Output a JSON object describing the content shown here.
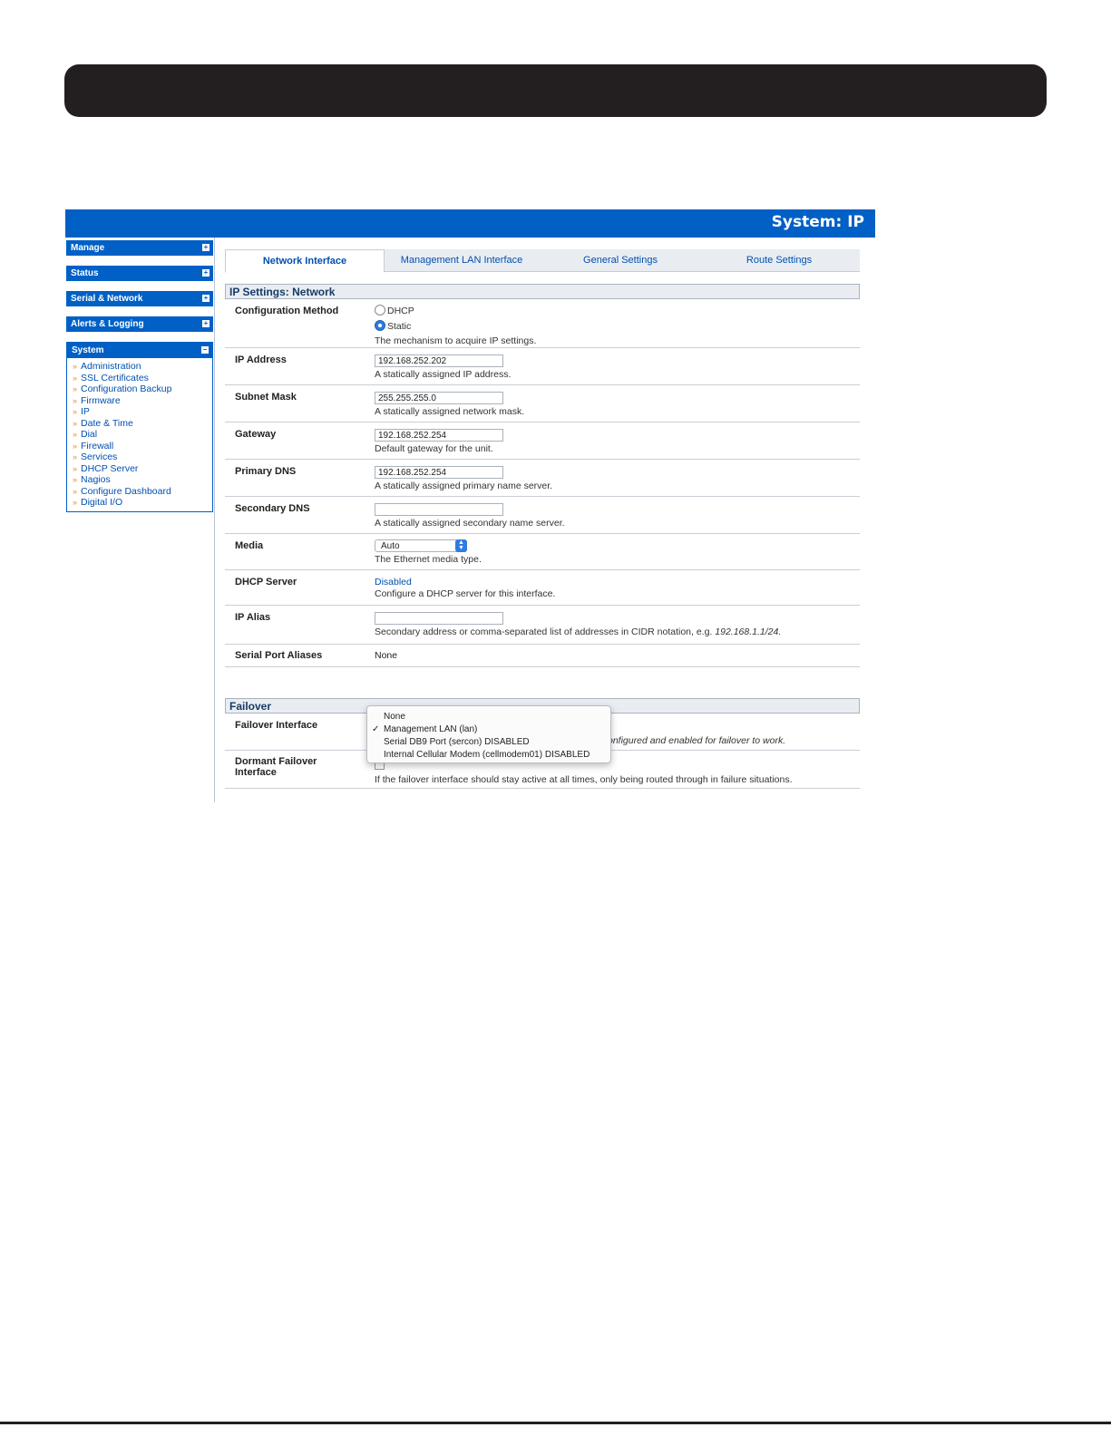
{
  "app": {
    "title": "System: IP"
  },
  "sidebar": {
    "sections": [
      {
        "label": "Manage",
        "toggle": "+"
      },
      {
        "label": "Status",
        "toggle": "+"
      },
      {
        "label": "Serial & Network",
        "toggle": "+"
      },
      {
        "label": "Alerts & Logging",
        "toggle": "+"
      }
    ],
    "system": {
      "label": "System",
      "toggle": "−",
      "items": [
        "Administration",
        "SSL Certificates",
        "Configuration Backup",
        "Firmware",
        "IP",
        "Date & Time",
        "Dial",
        "Firewall",
        "Services",
        "DHCP Server",
        "Nagios",
        "Configure Dashboard",
        "Digital I/O"
      ]
    }
  },
  "tabs": [
    {
      "label": "Network Interface",
      "active": true
    },
    {
      "label": "Management LAN Interface",
      "active": false
    },
    {
      "label": "General Settings",
      "active": false
    },
    {
      "label": "Route Settings",
      "active": false
    }
  ],
  "ip_settings": {
    "heading": "IP Settings: Network",
    "config_method": {
      "label": "Configuration Method",
      "options": [
        "DHCP",
        "Static"
      ],
      "selected": "Static",
      "hint": "The mechanism to acquire IP settings."
    },
    "ip_address": {
      "label": "IP Address",
      "value": "192.168.252.202",
      "hint": "A statically assigned IP address."
    },
    "subnet_mask": {
      "label": "Subnet Mask",
      "value": "255.255.255.0",
      "hint": "A statically assigned network mask."
    },
    "gateway": {
      "label": "Gateway",
      "value": "192.168.252.254",
      "hint": "Default gateway for the unit."
    },
    "primary_dns": {
      "label": "Primary DNS",
      "value": "192.168.252.254",
      "hint": "A statically assigned primary name server."
    },
    "secondary_dns": {
      "label": "Secondary DNS",
      "value": "",
      "hint": "A statically assigned secondary name server."
    },
    "media": {
      "label": "Media",
      "value": "Auto",
      "hint": "The Ethernet media type."
    },
    "dhcp_server": {
      "label": "DHCP Server",
      "value": "Disabled",
      "hint": "Configure a DHCP server for this interface."
    },
    "ip_alias": {
      "label": "IP Alias",
      "value": "",
      "hint": "Secondary address or comma-separated list of addresses in CIDR notation, e.g.",
      "hint_example": "192.168.1.1/24."
    },
    "serial_port_aliases": {
      "label": "Serial Port Aliases",
      "value": "None"
    }
  },
  "failover": {
    "heading": "Failover",
    "interface": {
      "label": "Failover Interface",
      "hint_partial": "onfigured and enabled for failover to work."
    },
    "dormant": {
      "label": "Dormant Failover Interface",
      "hint": "If the failover interface should stay active at all times, only being routed through in failure situations."
    },
    "dropdown_options": [
      {
        "label": "None",
        "checked": false
      },
      {
        "label": "Management LAN (lan)",
        "checked": true
      },
      {
        "label": "Serial DB9 Port (sercon) DISABLED",
        "checked": false
      },
      {
        "label": "Internal Cellular Modem (cellmodem01) DISABLED",
        "checked": false
      }
    ],
    "check_glyph": "✓"
  }
}
